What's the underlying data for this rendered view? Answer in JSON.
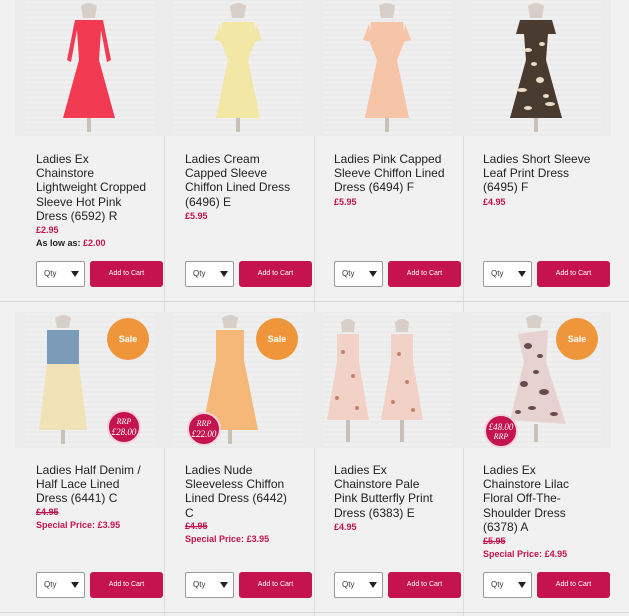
{
  "products": [
    {
      "title": "Ladies Ex Chainstore Lightweight Cropped Sleeve Hot Pink Dress (6592) R",
      "price": "£2.95",
      "as_low_label": "As low as:",
      "as_low_price": "£2.00",
      "qty_label": "Qty",
      "cart_label": "Add to Cart",
      "dress_color": "#f23a52",
      "dress_icon": "hot-pink-dress-image"
    },
    {
      "title": "Ladies Cream Capped Sleeve Chiffon Lined Dress (6496) E",
      "price": "£5.95",
      "qty_label": "Qty",
      "cart_label": "Add to Cart",
      "dress_color": "#f3e7a6",
      "dress_icon": "cream-dress-image"
    },
    {
      "title": "Ladies Pink Capped Sleeve Chiffon Lined Dress (6494) F",
      "price": "£5.95",
      "qty_label": "Qty",
      "cart_label": "Add to Cart",
      "dress_color": "#f6c4a6",
      "dress_icon": "pink-dress-image"
    },
    {
      "title": "Ladies Short Sleeve Leaf Print Dress (6495) F",
      "price": "£4.95",
      "qty_label": "Qty",
      "cart_label": "Add to Cart",
      "dress_color": "#4a3b30",
      "dress_icon": "leaf-print-dress-image"
    },
    {
      "title": "Ladies Half Denim / Half Lace Lined Dress (6441) C",
      "old_price": "£4.95",
      "special_label": "Special Price:",
      "special_price": "£3.95",
      "sale_label": "Sale",
      "rrp_label": "RRP",
      "rrp_value": "£28.00",
      "qty_label": "Qty",
      "cart_label": "Add to Cart",
      "dress_color": "#f1e3b8",
      "top_color": "#7b9bb8",
      "dress_icon": "denim-lace-dress-image"
    },
    {
      "title": "Ladies Nude Sleeveless Chiffon Lined Dress (6442) C",
      "old_price": "£4.95",
      "special_label": "Special Price:",
      "special_price": "£3.95",
      "sale_label": "Sale",
      "rrp_label": "RRP",
      "rrp_value": "£22.00",
      "qty_label": "Qty",
      "cart_label": "Add to Cart",
      "dress_color": "#f6b878",
      "dress_icon": "nude-chiffon-dress-image"
    },
    {
      "title": "Ladies Ex Chainstore Pale Pink Butterfly Print Dress (6383) E",
      "price": "£4.95",
      "qty_label": "Qty",
      "cart_label": "Add to Cart",
      "dress_color": "#f2d2c6",
      "dress_icon": "butterfly-print-dress-image"
    },
    {
      "title": "Ladies Ex Chainstore Lilac Floral Off-The-Shoulder Dress (6378) A",
      "old_price": "£5.95",
      "special_label": "Special Price:",
      "special_price": "£4.95",
      "sale_label": "Sale",
      "rrp_label": "RRP",
      "rrp_value": "£48.00",
      "qty_label": "Qty",
      "cart_label": "Add to Cart",
      "dress_color": "#e6d3d0",
      "dress_icon": "lilac-floral-dress-image"
    }
  ],
  "colors": {
    "accent": "#c4134e",
    "sale_badge": "#f0963a",
    "background": "#f1f1f1"
  }
}
